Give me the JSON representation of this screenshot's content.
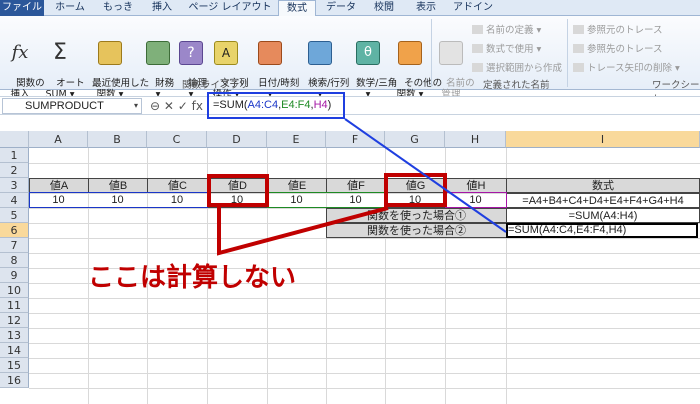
{
  "tabs": [
    "ファイル",
    "ホーム",
    "もっき",
    "挿入",
    "ページ レイアウト",
    "数式",
    "データ",
    "校閲",
    "表示",
    "アドイン"
  ],
  "active_tab": "数式",
  "ribbon": {
    "insert_function": "関数の\n挿入",
    "autosum": "オート\nSUM ▾",
    "recent": "最近使用した\n関数 ▾",
    "financial": "財務\n▾",
    "logical": "論理\n▾",
    "text": "文字列\n操作 ▾",
    "datetime": "日付/時刻\n▾",
    "lookup": "検索/行列\n▾",
    "math": "数学/三角\n▾",
    "more": "その他の\n関数 ▾",
    "group_library": "関数ライブラリ",
    "name_manager": "名前の\n管理",
    "define_name": "名前の定義 ▾",
    "use_in_formula": "数式で使用 ▾",
    "create_from_selection": "選択範囲から作成",
    "group_names": "定義された名前",
    "trace_precedents": "参照元のトレース",
    "trace_dependents": "参照先のトレース",
    "remove_arrows": "トレース矢印の削除 ▾",
    "group_audit": "ワークシート"
  },
  "formula_bar": {
    "name_box": "SUMPRODUCT",
    "name_box_arrow": "▾",
    "buttons": "⊖ ✕ ✓ fx",
    "prefix": "=SUM(",
    "ref1": "A4:C4",
    "sep1": ",",
    "ref2": "E4:F4",
    "sep2": ",",
    "ref3": "H4",
    "suffix": ")"
  },
  "columns": [
    "A",
    "B",
    "C",
    "D",
    "E",
    "F",
    "G",
    "H",
    "I"
  ],
  "rows": [
    "1",
    "2",
    "3",
    "4",
    "5",
    "6",
    "7",
    "8",
    "9",
    "10",
    "11",
    "12",
    "13",
    "14",
    "15",
    "16"
  ],
  "sheet": {
    "headers": [
      "値A",
      "値B",
      "値C",
      "値D",
      "値E",
      "値F",
      "値G",
      "値H"
    ],
    "values": [
      "10",
      "10",
      "10",
      "10",
      "10",
      "10",
      "10",
      "10"
    ],
    "formula_header": "数式",
    "formula_plain": "=A4+B4+C4+D4+E4+F4+G4+H4",
    "note1": "関数を使った場合①",
    "formula_func1": "=SUM(A4:H4)",
    "note2": "関数を使った場合②",
    "formula_func2": "=SUM(A4:C4,E4:F4,H4)"
  },
  "callout": "ここは計算しない",
  "colors": {
    "annotation_red": "#c00000",
    "annotation_blue": "#1f3fe0",
    "ref_blue": "#1a36c8",
    "ref_green": "#1e8a24",
    "ref_purple": "#a516a5"
  }
}
